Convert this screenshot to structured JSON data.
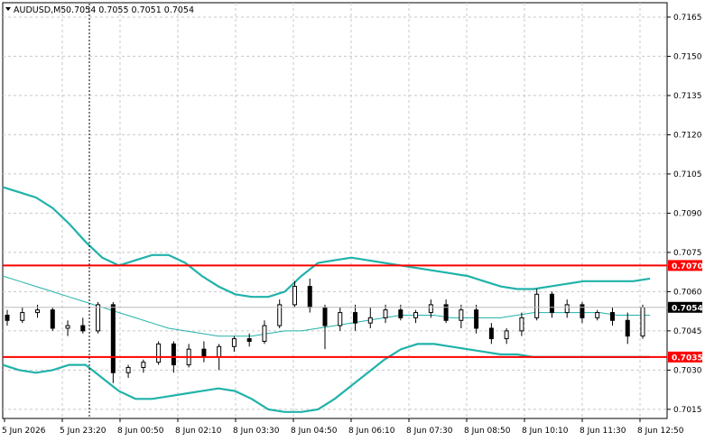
{
  "header": {
    "symbol": "AUDUSD,M5",
    "ohlc": "0.7054 0.7055 0.7051 0.7054"
  },
  "chart_data": {
    "type": "candlestick",
    "symbol": "AUDUSD",
    "timeframe": "M5",
    "grid": true,
    "y_ticks": [
      "0.7165",
      "0.7150",
      "0.7135",
      "0.7120",
      "0.7105",
      "0.7090",
      "0.7075",
      "0.7060",
      "0.7045",
      "0.7030",
      "0.7015"
    ],
    "x_ticks": [
      "5 Jun 2026",
      "5 Jun 23:20",
      "8 Jun 00:50",
      "8 Jun 02:10",
      "8 Jun 03:30",
      "8 Jun 04:50",
      "8 Jun 06:10",
      "8 Jun 07:30",
      "8 Jun 08:50",
      "8 Jun 10:10",
      "8 Jun 11:30",
      "8 Jun 12:50"
    ],
    "ylim": [
      0.70115,
      0.71705
    ],
    "levels": [
      {
        "value": 0.707,
        "label": "0.7070",
        "color": "#ff0000"
      },
      {
        "value": 0.7035,
        "label": "0.7035",
        "color": "#ff0000"
      }
    ],
    "current_price": {
      "value": 0.7054,
      "label": "0.7054",
      "color": "#000000"
    },
    "bollinger": {
      "color": "#20b2aa",
      "upper": [
        0.71,
        0.7098,
        0.7096,
        0.7092,
        0.7086,
        0.7079,
        0.7073,
        0.707,
        0.7072,
        0.7074,
        0.7074,
        0.7071,
        0.7066,
        0.7062,
        0.7059,
        0.7058,
        0.7058,
        0.706,
        0.7066,
        0.7071,
        0.7072,
        0.7073,
        0.7072,
        0.7071,
        0.707,
        0.7069,
        0.7068,
        0.7067,
        0.7066,
        0.7064,
        0.7062,
        0.7061,
        0.7061,
        0.7062,
        0.7063,
        0.7064,
        0.7064,
        0.7064,
        0.7064,
        0.7065
      ],
      "middle": [
        0.7066,
        0.7064,
        0.7062,
        0.706,
        0.7058,
        0.7056,
        0.7054,
        0.7052,
        0.705,
        0.7048,
        0.7046,
        0.7045,
        0.7044,
        0.7043,
        0.7043,
        0.7043,
        0.7044,
        0.7045,
        0.7045,
        0.7046,
        0.7047,
        0.7048,
        0.7049,
        0.705,
        0.7051,
        0.7051,
        0.7051,
        0.705,
        0.705,
        0.705,
        0.705,
        0.7051,
        0.7052,
        0.7052,
        0.7052,
        0.7052,
        0.7052,
        0.7051,
        0.7051,
        0.7051
      ],
      "lower": [
        0.7032,
        0.703,
        0.7029,
        0.703,
        0.7032,
        0.7032,
        0.7027,
        0.7022,
        0.7019,
        0.7019,
        0.702,
        0.7021,
        0.7022,
        0.7023,
        0.7022,
        0.7019,
        0.7015,
        0.7014,
        0.7014,
        0.7015,
        0.7019,
        0.7024,
        0.7029,
        0.7034,
        0.7038,
        0.704,
        0.704,
        0.7039,
        0.7038,
        0.7037,
        0.7036,
        0.7036,
        0.7035,
        0.7035,
        0.7035,
        0.7035,
        0.7035,
        0.7035,
        0.7035,
        0.7035
      ]
    },
    "candles": [
      {
        "o": 0.7051,
        "h": 0.7053,
        "l": 0.7047,
        "c": 0.7049
      },
      {
        "o": 0.7049,
        "h": 0.7054,
        "l": 0.7048,
        "c": 0.7052
      },
      {
        "o": 0.7052,
        "h": 0.7055,
        "l": 0.705,
        "c": 0.7053
      },
      {
        "o": 0.7053,
        "h": 0.7054,
        "l": 0.7045,
        "c": 0.7046
      },
      {
        "o": 0.7046,
        "h": 0.7049,
        "l": 0.7043,
        "c": 0.7047
      },
      {
        "o": 0.7047,
        "h": 0.705,
        "l": 0.7044,
        "c": 0.7045
      },
      {
        "o": 0.7045,
        "h": 0.7056,
        "l": 0.7044,
        "c": 0.7055
      },
      {
        "o": 0.7055,
        "h": 0.7056,
        "l": 0.7025,
        "c": 0.7029
      },
      {
        "o": 0.7029,
        "h": 0.7032,
        "l": 0.7027,
        "c": 0.7031
      },
      {
        "o": 0.7031,
        "h": 0.7034,
        "l": 0.7029,
        "c": 0.7033
      },
      {
        "o": 0.7033,
        "h": 0.7041,
        "l": 0.7032,
        "c": 0.704
      },
      {
        "o": 0.704,
        "h": 0.7041,
        "l": 0.7029,
        "c": 0.7032
      },
      {
        "o": 0.7032,
        "h": 0.704,
        "l": 0.7031,
        "c": 0.7038
      },
      {
        "o": 0.7038,
        "h": 0.7041,
        "l": 0.7033,
        "c": 0.7035
      },
      {
        "o": 0.7035,
        "h": 0.704,
        "l": 0.703,
        "c": 0.7039
      },
      {
        "o": 0.7039,
        "h": 0.7043,
        "l": 0.7037,
        "c": 0.7042
      },
      {
        "o": 0.7042,
        "h": 0.7044,
        "l": 0.7039,
        "c": 0.7041
      },
      {
        "o": 0.7041,
        "h": 0.7049,
        "l": 0.704,
        "c": 0.7047
      },
      {
        "o": 0.7047,
        "h": 0.7057,
        "l": 0.7046,
        "c": 0.7055
      },
      {
        "o": 0.7055,
        "h": 0.7064,
        "l": 0.7054,
        "c": 0.7062
      },
      {
        "o": 0.7062,
        "h": 0.7065,
        "l": 0.7052,
        "c": 0.7054
      },
      {
        "o": 0.7054,
        "h": 0.7055,
        "l": 0.7038,
        "c": 0.7047
      },
      {
        "o": 0.7047,
        "h": 0.7054,
        "l": 0.7045,
        "c": 0.7052
      },
      {
        "o": 0.7052,
        "h": 0.7055,
        "l": 0.7045,
        "c": 0.7048
      },
      {
        "o": 0.7048,
        "h": 0.7054,
        "l": 0.7046,
        "c": 0.705
      },
      {
        "o": 0.705,
        "h": 0.7055,
        "l": 0.7048,
        "c": 0.7053
      },
      {
        "o": 0.7053,
        "h": 0.7055,
        "l": 0.7049,
        "c": 0.705
      },
      {
        "o": 0.705,
        "h": 0.7053,
        "l": 0.7048,
        "c": 0.7052
      },
      {
        "o": 0.7052,
        "h": 0.7057,
        "l": 0.705,
        "c": 0.7055
      },
      {
        "o": 0.7055,
        "h": 0.7057,
        "l": 0.7048,
        "c": 0.7049
      },
      {
        "o": 0.7049,
        "h": 0.7055,
        "l": 0.7046,
        "c": 0.7053
      },
      {
        "o": 0.7053,
        "h": 0.7055,
        "l": 0.7044,
        "c": 0.7046
      },
      {
        "o": 0.7046,
        "h": 0.7048,
        "l": 0.704,
        "c": 0.7042
      },
      {
        "o": 0.7042,
        "h": 0.7046,
        "l": 0.704,
        "c": 0.7045
      },
      {
        "o": 0.7045,
        "h": 0.7052,
        "l": 0.7043,
        "c": 0.705
      },
      {
        "o": 0.705,
        "h": 0.7061,
        "l": 0.7049,
        "c": 0.7059
      },
      {
        "o": 0.7059,
        "h": 0.706,
        "l": 0.705,
        "c": 0.7052
      },
      {
        "o": 0.7052,
        "h": 0.7057,
        "l": 0.705,
        "c": 0.7055
      },
      {
        "o": 0.7055,
        "h": 0.7056,
        "l": 0.7048,
        "c": 0.705
      },
      {
        "o": 0.705,
        "h": 0.7053,
        "l": 0.7049,
        "c": 0.7052
      },
      {
        "o": 0.7052,
        "h": 0.7054,
        "l": 0.7047,
        "c": 0.7049
      },
      {
        "o": 0.7049,
        "h": 0.7052,
        "l": 0.704,
        "c": 0.7043
      },
      {
        "o": 0.7043,
        "h": 0.7055,
        "l": 0.7042,
        "c": 0.7054
      }
    ]
  }
}
